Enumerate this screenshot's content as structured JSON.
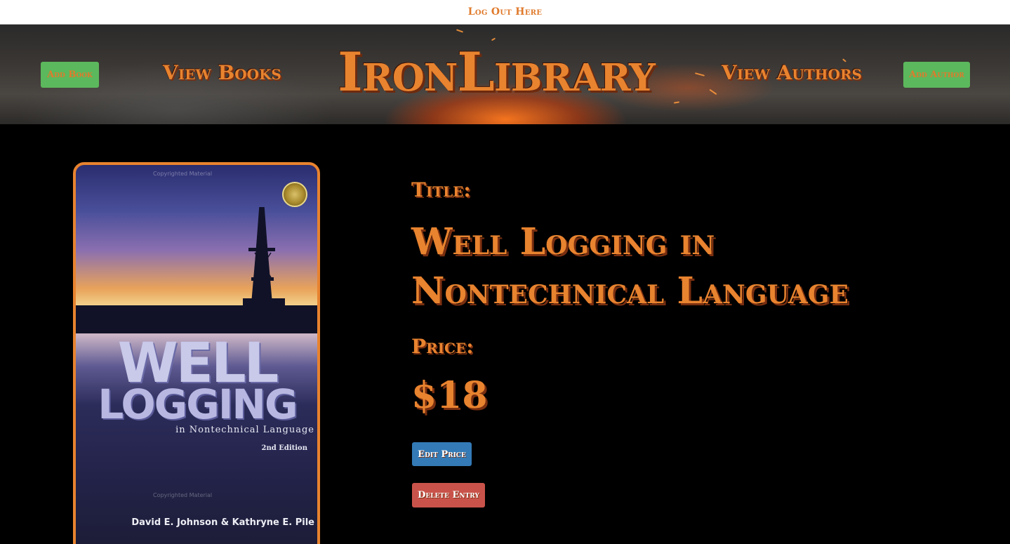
{
  "topbar": {
    "logout_label": "Log Out Here"
  },
  "header": {
    "brand": "IronLibrary",
    "add_book_label": "Add Book",
    "view_books_label": "View Books",
    "view_authors_label": "View Authors",
    "add_author_label": "Add Author"
  },
  "cover": {
    "title_line1": "WELL",
    "title_line2": "LOGGING",
    "subtitle": "in Nontechnical Language",
    "edition": "2nd Edition",
    "authors": "David E. Johnson & Kathryne E. Pile",
    "watermark": "Copyrighted Material"
  },
  "book": {
    "title_label": "Title:",
    "title": "Well Logging in Nontechnical Language",
    "price_label": "Price:",
    "price": "$18"
  },
  "actions": {
    "edit_price_label": "Edit Price",
    "delete_entry_label": "Delete Entry"
  },
  "colors": {
    "accent": "#e8832f",
    "green": "#5cb85c",
    "blue": "#337ab7",
    "red": "#c9534a"
  }
}
